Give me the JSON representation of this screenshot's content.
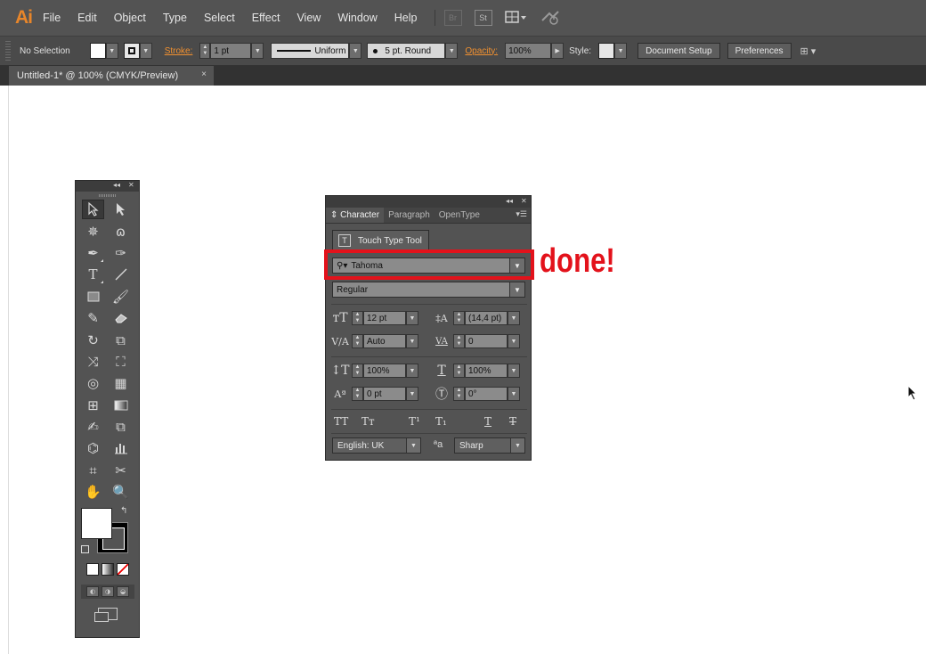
{
  "app": {
    "logo": "Ai"
  },
  "menu": [
    "File",
    "Edit",
    "Object",
    "Type",
    "Select",
    "Effect",
    "View",
    "Window",
    "Help"
  ],
  "menubar_icons": [
    "Br",
    "St"
  ],
  "control_bar": {
    "selection_label": "No Selection",
    "stroke_label": "Stroke:",
    "stroke_weight": "1 pt",
    "variable_width": "Uniform",
    "brush": "5 pt. Round",
    "opacity_label": "Opacity:",
    "opacity_value": "100%",
    "style_label": "Style:",
    "document_setup": "Document Setup",
    "preferences": "Preferences"
  },
  "document_tab": {
    "title": "Untitled-1* @ 100% (CMYK/Preview)",
    "close": "×"
  },
  "character_panel": {
    "tabs": [
      "Character",
      "Paragraph",
      "OpenType"
    ],
    "touch_type_button": "Touch Type Tool",
    "font_family": "Tahoma",
    "font_style": "Regular",
    "font_size": "12 pt",
    "leading": "(14,4 pt)",
    "kerning": "Auto",
    "tracking": "0",
    "vertical_scale": "100%",
    "horizontal_scale": "100%",
    "baseline_shift": "0 pt",
    "rotation": "0°",
    "language": "English: UK",
    "anti_aliasing": "Sharp"
  },
  "annotation": {
    "text": "done!",
    "color": "#e3121b"
  },
  "colors": {
    "menubar": "#535353",
    "panel": "#535353",
    "accent": "#e8862a"
  }
}
